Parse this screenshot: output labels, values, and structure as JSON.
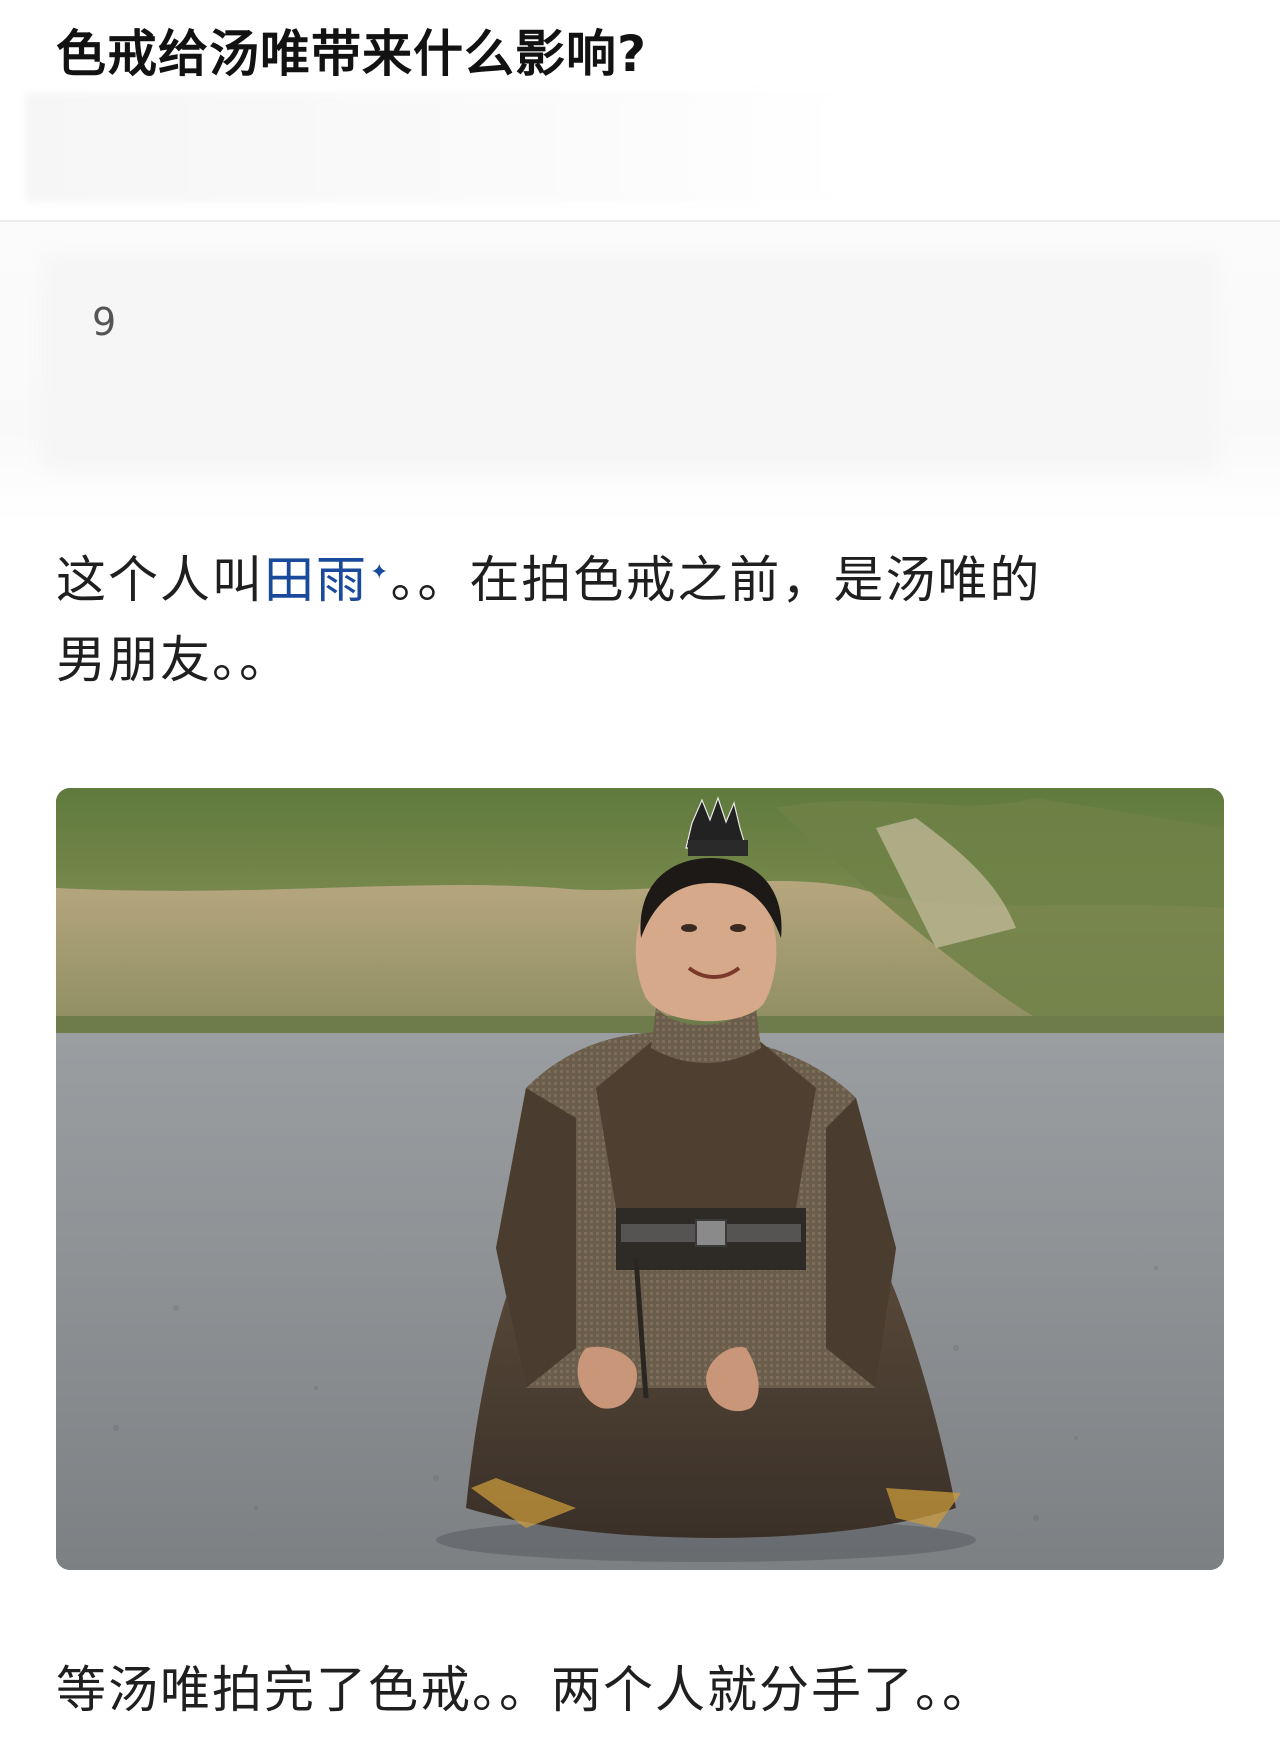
{
  "question": {
    "title": "色戒给汤唯带来什么影响?"
  },
  "author": {
    "visible_fragment": "9"
  },
  "answer": {
    "paragraph1": {
      "prefix": "这个人叫",
      "link_text": "田雨",
      "suffix_line1": "。。在拍色戒之前，是汤唯的",
      "suffix_line2": "男朋友。。"
    },
    "figure": {
      "description_icon": "kneeling-man-photo"
    },
    "paragraph2": {
      "text": "等汤唯拍完了色戒。。两个人就分手了。。"
    }
  },
  "colors": {
    "link": "#1a4a9c",
    "text": "#1f1f1f",
    "title": "#121212"
  }
}
